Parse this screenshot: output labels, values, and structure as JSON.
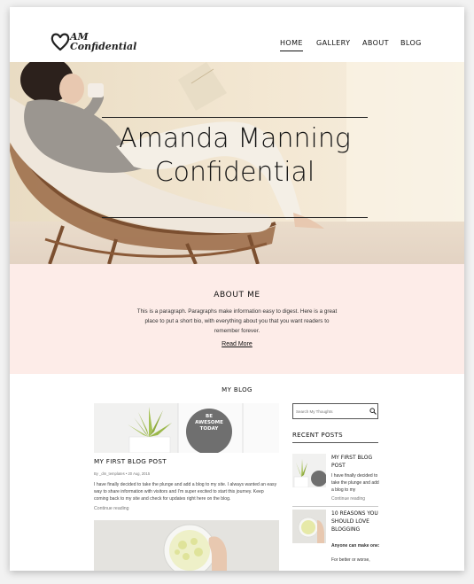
{
  "logo": {
    "text_line1": "AM",
    "text_line2": "Confidential"
  },
  "nav": {
    "items": [
      "HOME",
      "GALLERY",
      "ABOUT",
      "BLOG"
    ],
    "active": "HOME"
  },
  "hero": {
    "title_line1": "Amanda Manning",
    "title_line2": "Confidential"
  },
  "about": {
    "title": "ABOUT ME",
    "text": "This is a paragraph. Paragraphs make information easy to digest. Here is a great place to put a short bio, with everything about you that you want readers to remember forever.",
    "read_more": "Read More"
  },
  "blog": {
    "label": "MY BLOG",
    "post": {
      "title": "MY FIRST BLOG POST",
      "meta": "By _dm_templates • 20 Aug, 2015",
      "excerpt": "I have finally decided to take the plunge and add a blog to my site. I always wanted an easy way to share information with visitors and I'm super excited to start this journey. Keep coming back to my site and check for updates right here on the blog.",
      "continue": "Continue reading",
      "sign_line1": "BE",
      "sign_line2": "AWESOME",
      "sign_line3": "TODAY"
    }
  },
  "sidebar": {
    "search_placeholder": "Search My Thoughts",
    "recent_title": "RECENT POSTS",
    "posts": [
      {
        "title": "MY FIRST BLOG POST",
        "excerpt": "I have finally decided to take the plunge and add a blog to my",
        "continue": "Continue reading"
      },
      {
        "title": "10 REASONS YOU SHOULD LOVE BLOGGING",
        "excerpt_bold": "Anyone can make one:",
        "excerpt": "For better or worse,"
      }
    ]
  },
  "colors": {
    "about_bg": "#fdece8",
    "hero_tint": "#f6ead6",
    "text": "#111111"
  }
}
